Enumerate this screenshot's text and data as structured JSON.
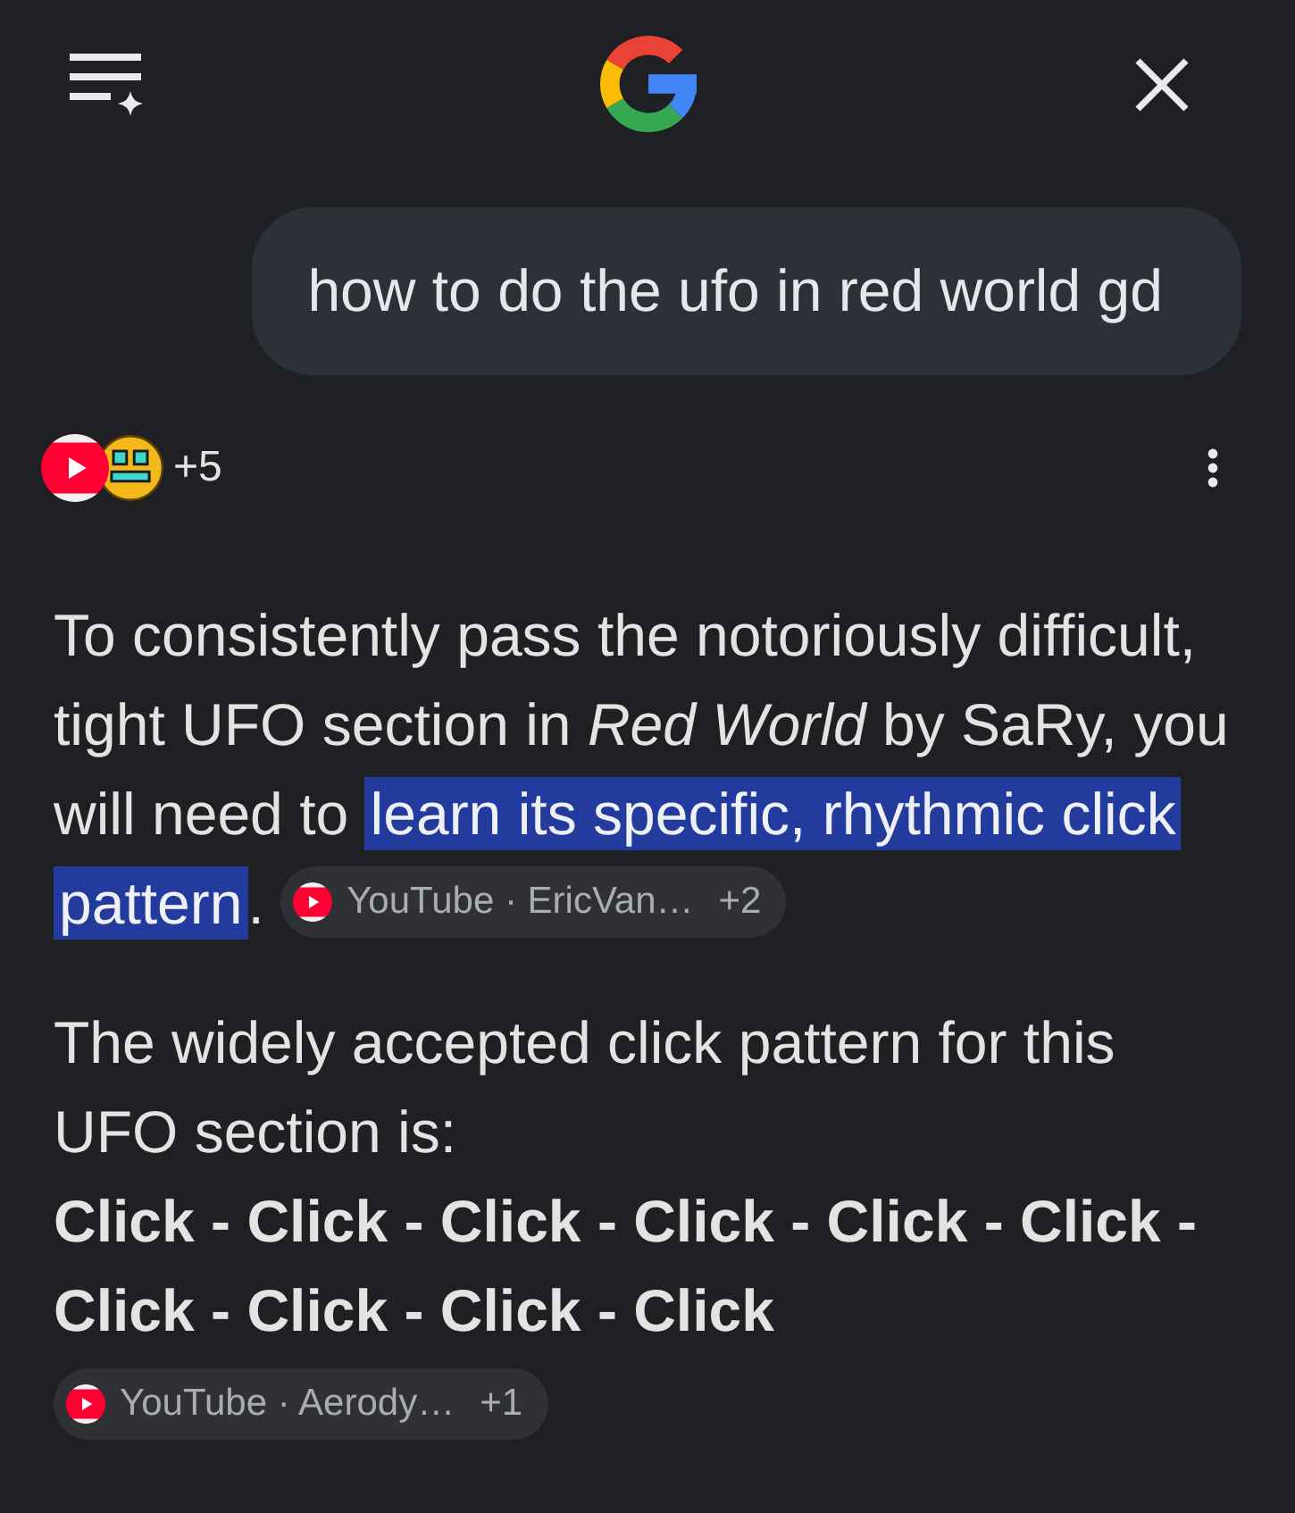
{
  "query": {
    "text": "how to do the ufo in red world gd"
  },
  "sources": {
    "more": "+5"
  },
  "answer": [
    {
      "kind": "paragraph",
      "text": "To consistently pass the notoriously difficult, tight UFO section in *Red World* by SaRy, you will need to",
      "highlight": "learn its specific, rhythmic click pattern",
      "text_after": ".",
      "citation": {
        "label": "YouTube · EricVan…",
        "more": "+2"
      }
    },
    {
      "kind": "paragraph",
      "text": "The widely accepted click pattern for this UFO section is:"
    },
    {
      "kind": "strong",
      "text": "Click - Click - Click - Click - Click - Click - Click - Click - Click - Click"
    },
    {
      "kind": "citation",
      "label": "YouTube · Aerody…",
      "more": "+1"
    }
  ]
}
